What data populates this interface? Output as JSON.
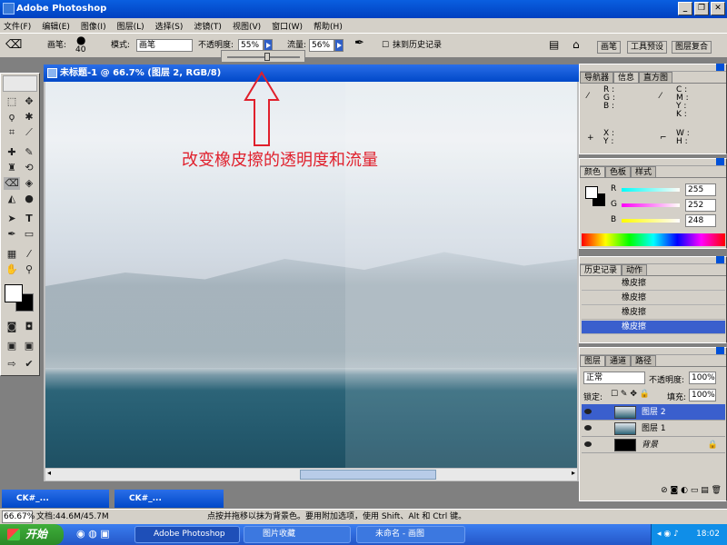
{
  "app": {
    "title": "Adobe Photoshop"
  },
  "menu": [
    "文件(F)",
    "编辑(E)",
    "图像(I)",
    "图层(L)",
    "选择(S)",
    "滤镜(T)",
    "视图(V)",
    "窗口(W)",
    "帮助(H)"
  ],
  "options": {
    "brush_label": "画笔:",
    "brush_size": "40",
    "mode_label": "模式:",
    "mode_value": "画笔",
    "opacity_label": "不透明度:",
    "opacity_value": "55%",
    "flow_label": "流量:",
    "flow_value": "56%",
    "history_label": "抹到历史记录",
    "tabs": [
      "画笔",
      "工具预设",
      "图层复合"
    ]
  },
  "opacity_slider": {
    "value": 0.55
  },
  "document": {
    "title": "未标题-1 @ 66.7% (图层 2, RGB/8)"
  },
  "annotation": "改变橡皮擦的透明度和流量",
  "navigator": {
    "tabs": [
      "导航器",
      "信息",
      "直方图"
    ],
    "rgb": [
      "R :",
      "G :",
      "B :"
    ],
    "cmyk": [
      "C :",
      "M :",
      "Y :",
      "K :"
    ],
    "xy": [
      "X :",
      "Y :"
    ],
    "wh": [
      "W :",
      "H :"
    ]
  },
  "color": {
    "tabs": [
      "颜色",
      "色板",
      "样式"
    ],
    "channels": [
      {
        "label": "R",
        "value": "255",
        "color": "#ff0000"
      },
      {
        "label": "G",
        "value": "252",
        "color": "#00b000"
      },
      {
        "label": "B",
        "value": "248",
        "color": "#0000ff"
      }
    ]
  },
  "history": {
    "tabs": [
      "历史记录",
      "动作"
    ],
    "items": [
      "橡皮擦",
      "橡皮擦",
      "橡皮擦",
      "橡皮擦"
    ]
  },
  "layers": {
    "tabs": [
      "图层",
      "通道",
      "路径"
    ],
    "blend_mode": "正常",
    "opacity_label": "不透明度:",
    "opacity_value": "100%",
    "lock_label": "锁定:",
    "fill_label": "填充:",
    "fill_value": "100%",
    "items": [
      "图层 2",
      "图层 1",
      "背景"
    ]
  },
  "minimized": [
    "CK#_...",
    "CK#_..."
  ],
  "status": {
    "zoom": "66.67%",
    "doc": "文档:44.6M/45.7M",
    "hint": "点按并拖移以抹为背景色。要用附加选项，使用 Shift、Alt 和 Ctrl 键。"
  },
  "taskbar": {
    "start": "开始",
    "items": [
      "Adobe Photoshop",
      "图片收藏",
      "未命名 - 画图"
    ],
    "clock": "18:02"
  }
}
